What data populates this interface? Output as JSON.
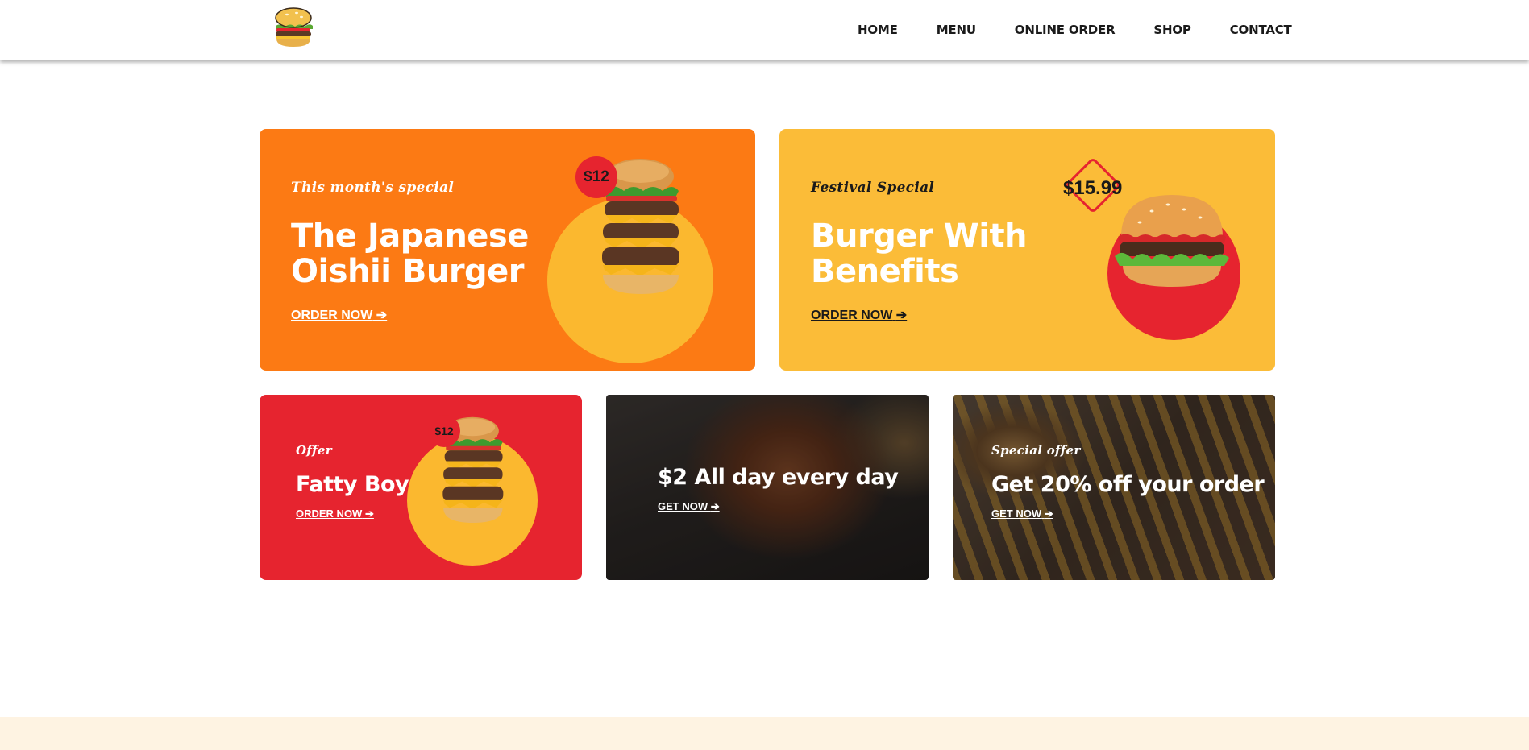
{
  "nav": {
    "items": [
      {
        "label": "HOME"
      },
      {
        "label": "MENU"
      },
      {
        "label": "ONLINE ORDER"
      },
      {
        "label": "SHOP"
      },
      {
        "label": "CONTACT"
      }
    ]
  },
  "cards": {
    "japanese": {
      "kicker": "This month's special",
      "title_line1": "The Japanese",
      "title_line2": "Oishii Burger",
      "cta": "ORDER NOW",
      "price": "$12",
      "bg_color": "#fc7a14"
    },
    "festival": {
      "kicker": "Festival Special",
      "title_line1": "Burger With",
      "title_line2": "Benefits",
      "cta": "ORDER NOW",
      "price": "$15.99",
      "bg_color": "#fbbc38"
    },
    "fatty": {
      "kicker": "Offer",
      "title": "Fatty Boy",
      "cta": "ORDER NOW",
      "price": "$12",
      "bg_color": "#e6242f"
    },
    "allday": {
      "title": "$2 All day every day",
      "cta": "GET NOW"
    },
    "discount": {
      "kicker": "Special offer",
      "title": "Get 20% off your order",
      "cta": "GET NOW"
    }
  },
  "icons": {
    "arrow": "arrow-right-icon",
    "logo": "burger-logo-icon"
  },
  "colors": {
    "accent_red": "#e6242f",
    "accent_orange": "#fc7a14",
    "accent_yellow": "#fbbc38",
    "footer_bg": "#fef3e2"
  }
}
